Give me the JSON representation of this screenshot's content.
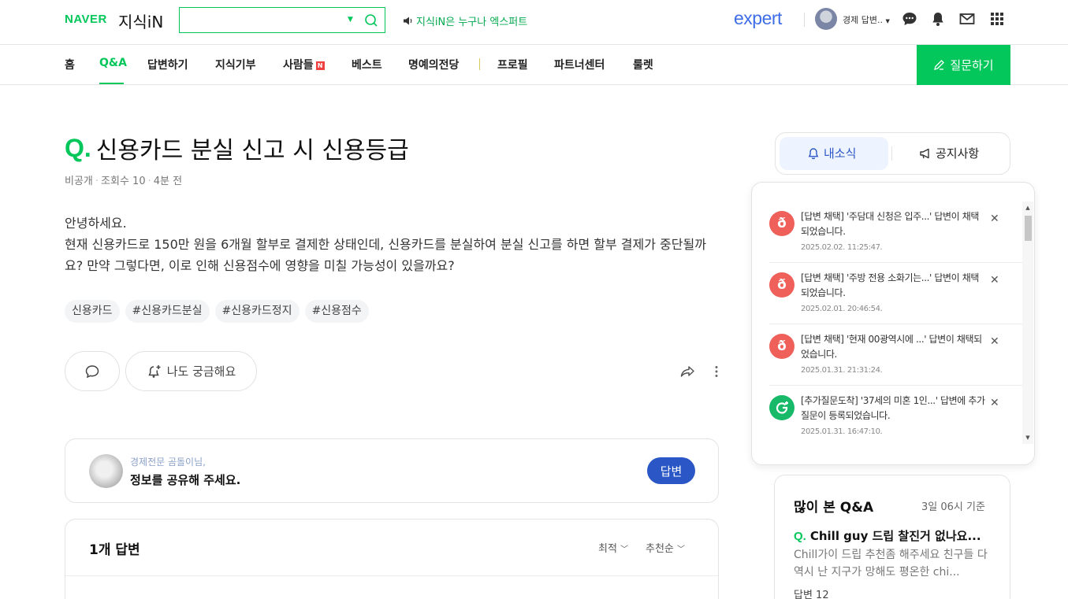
{
  "header": {
    "naver": "NAVER",
    "service": "지식iN",
    "search_placeholder": "",
    "notice": "지식iN은 누구나 엑스퍼트",
    "expert": "expert",
    "user_name": "경제 답변..",
    "colors": {
      "brand": "#03c75a",
      "expert": "#3f6ee8"
    }
  },
  "nav": {
    "items": [
      "홈",
      "Q&A",
      "답변하기",
      "지식기부",
      "사람들",
      "베스트",
      "명예의전당",
      "프로필",
      "파트너센터",
      "룰렛"
    ],
    "active": "Q&A",
    "badge": "N",
    "ask_button": "질문하기"
  },
  "question": {
    "mark": "Q.",
    "title": "신용카드 분실 신고 시 신용등급",
    "privacy": "비공개",
    "views": "조회수 10",
    "time": "4분 전",
    "body_lines": [
      "안녕하세요.",
      "현재 신용카드로 150만 원을 6개월 할부로 결제한 상태인데, 신용카드를 분실하여 분실 신고를 하면 할부 결제가 중단될까요? 만약 그렇다면, 이로 인해 신용점수에 영향을 미칠 가능성이 있을까요?"
    ],
    "tags": [
      "신용카드",
      "#신용카드분실",
      "#신용카드정지",
      "#신용점수"
    ],
    "curious_label": "나도 궁금해요"
  },
  "prompt": {
    "line1": "경제전문 곰돌이님,",
    "line2": "정보를 공유해 주세요.",
    "answer_button": "답변"
  },
  "answers": {
    "count": "1개 답변",
    "sort_latest": "최적",
    "sort_recommend": "추천순"
  },
  "right_tabs": {
    "news": "내소식",
    "notice": "공지사항"
  },
  "notifications": [
    {
      "type": "adopt",
      "text": "[답변 채택] '주담대 신청은 입주...' 답변이 채택되었습니다.",
      "time": "2025.02.02. 11:25:47.",
      "color": "#f0605a"
    },
    {
      "type": "adopt",
      "text": "[답변 채택] '주방 전용 소화기는...' 답변이 채택되었습니다.",
      "time": "2025.02.01. 20:46:54.",
      "color": "#f0605a"
    },
    {
      "type": "adopt",
      "text": "[답변 채택] '현재 00광역시에 ...' 답변이 채택되었습니다.",
      "time": "2025.01.31. 21:31:24.",
      "color": "#f0605a"
    },
    {
      "type": "followup",
      "text": "[추가질문도착] '37세의 미혼 1인...' 답변에 추가질문이 등록되었습니다.",
      "time": "2025.01.31. 16:47:10.",
      "color": "#19b96a"
    }
  ],
  "popular": {
    "title": "많이 본 Q&A",
    "date": "3일 06시 기준",
    "q_mark": "Q.",
    "question": "Chill guy 드립 찰진거 없나요...",
    "snippet": "Chill가이 드립 추천좀 해주세요 친구들 다 역시 난 지구가 망해도 평온한 chi...",
    "answers": "답변 12"
  }
}
